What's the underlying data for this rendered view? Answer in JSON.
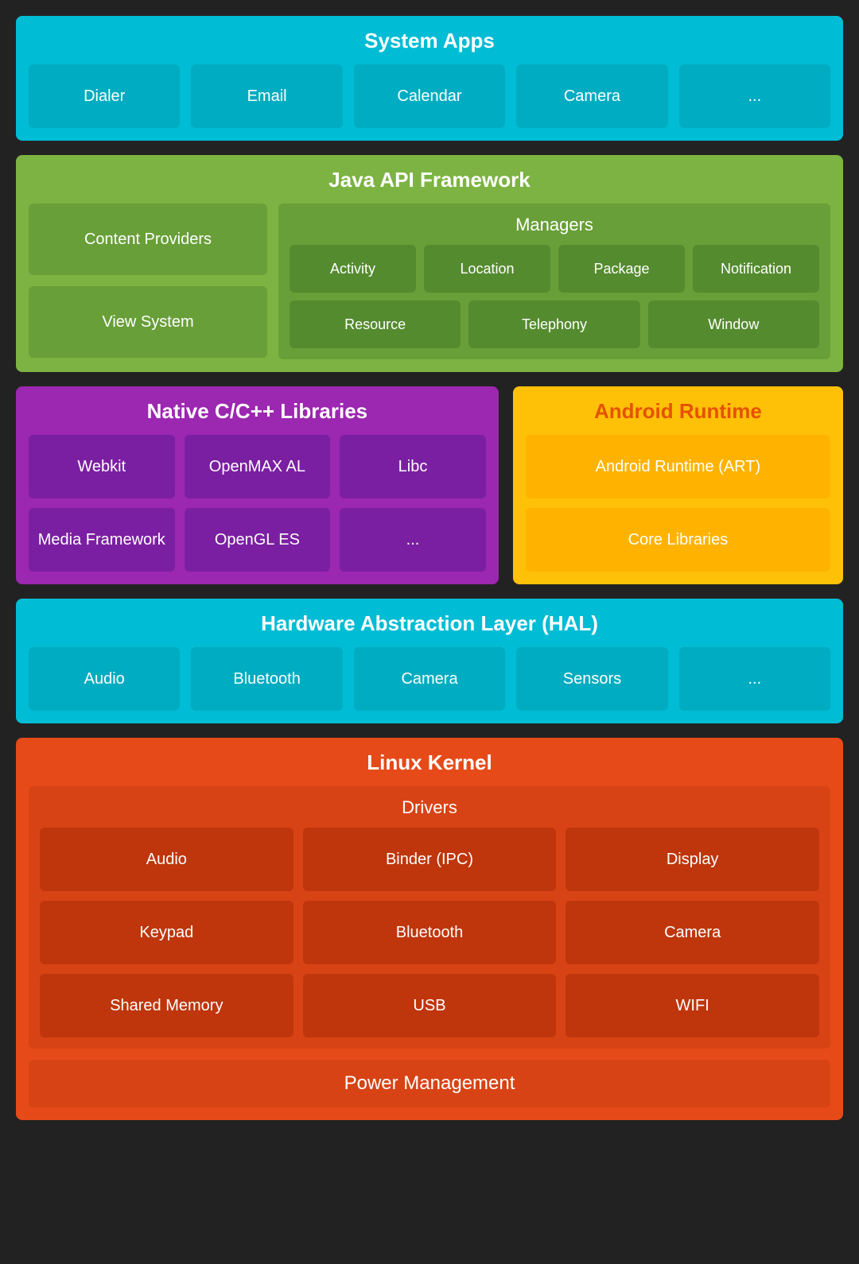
{
  "systemApps": {
    "title": "System Apps",
    "items": [
      "Dialer",
      "Email",
      "Calendar",
      "Camera",
      "..."
    ]
  },
  "javaApi": {
    "title": "Java API Framework",
    "left": [
      "Content Providers",
      "View System"
    ],
    "managers": {
      "title": "Managers",
      "row1": [
        "Activity",
        "Location",
        "Package",
        "Notification"
      ],
      "row2": [
        "Resource",
        "Telephony",
        "Window"
      ]
    }
  },
  "nativeLibs": {
    "title": "Native C/C++ Libraries",
    "items": [
      "Webkit",
      "OpenMAX AL",
      "Libc",
      "Media Framework",
      "OpenGL ES",
      "..."
    ]
  },
  "androidRuntime": {
    "title": "Android Runtime",
    "items": [
      "Android Runtime (ART)",
      "Core Libraries"
    ]
  },
  "hal": {
    "title": "Hardware Abstraction Layer (HAL)",
    "items": [
      "Audio",
      "Bluetooth",
      "Camera",
      "Sensors",
      "..."
    ]
  },
  "linuxKernel": {
    "title": "Linux Kernel",
    "drivers": {
      "title": "Drivers",
      "items": [
        "Audio",
        "Binder (IPC)",
        "Display",
        "Keypad",
        "Bluetooth",
        "Camera",
        "Shared Memory",
        "USB",
        "WIFI"
      ]
    },
    "powerManagement": "Power Management"
  }
}
